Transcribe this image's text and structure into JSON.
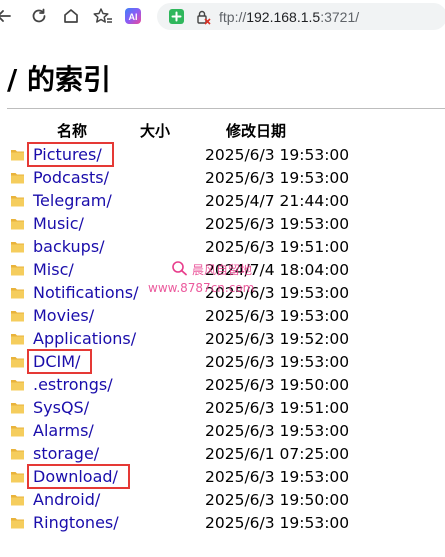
{
  "browser": {
    "url": {
      "scheme": "ftp://",
      "host": "192.168.1.5",
      "port": ":3721/"
    }
  },
  "page": {
    "title": "/ 的索引",
    "columns": {
      "name": "名称",
      "size": "大小",
      "date": "修改日期"
    },
    "entries": [
      {
        "name": "Pictures/",
        "date": "2025/6/3 19:53:00",
        "highlighted": true
      },
      {
        "name": "Podcasts/",
        "date": "2025/6/3 19:53:00",
        "highlighted": false
      },
      {
        "name": "Telegram/",
        "date": "2025/4/7 21:44:00",
        "highlighted": false
      },
      {
        "name": "Music/",
        "date": "2025/6/3 19:53:00",
        "highlighted": false
      },
      {
        "name": "backups/",
        "date": "2025/6/3 19:51:00",
        "highlighted": false
      },
      {
        "name": "Misc/",
        "date": "2024/7/4 18:04:00",
        "highlighted": false
      },
      {
        "name": "Notifications/",
        "date": "2025/6/3 19:53:00",
        "highlighted": false
      },
      {
        "name": "Movies/",
        "date": "2025/6/3 19:53:00",
        "highlighted": false
      },
      {
        "name": "Applications/",
        "date": "2025/6/3 19:52:00",
        "highlighted": false
      },
      {
        "name": "DCIM/",
        "date": "2025/6/3 19:53:00",
        "highlighted": true
      },
      {
        "name": ".estrongs/",
        "date": "2025/6/3 19:50:00",
        "highlighted": false
      },
      {
        "name": "SysQS/",
        "date": "2025/6/3 19:51:00",
        "highlighted": false
      },
      {
        "name": "Alarms/",
        "date": "2025/6/3 19:53:00",
        "highlighted": false
      },
      {
        "name": "storage/",
        "date": "2025/6/1 07:25:00",
        "highlighted": false
      },
      {
        "name": "Download/",
        "date": "2025/6/3 19:53:00",
        "highlighted": true
      },
      {
        "name": "Android/",
        "date": "2025/6/3 19:50:00",
        "highlighted": false
      },
      {
        "name": "Ringtones/",
        "date": "2025/6/3 19:53:00",
        "highlighted": false
      }
    ]
  },
  "watermark": {
    "line1": "晨风自留地",
    "line2": "www.8787cn.com"
  },
  "icons": {
    "nav": [
      "back-icon",
      "reload-icon",
      "home-icon",
      "favorites-icon",
      "copilot-icon"
    ],
    "address": [
      "shield-icon",
      "not-secure-lock-icon"
    ],
    "entry": "folder-icon"
  },
  "colors": {
    "link": "#1a0dab",
    "highlight_box": "#e53935",
    "folder": "#f2c14e",
    "watermark": "#e83e8c"
  }
}
